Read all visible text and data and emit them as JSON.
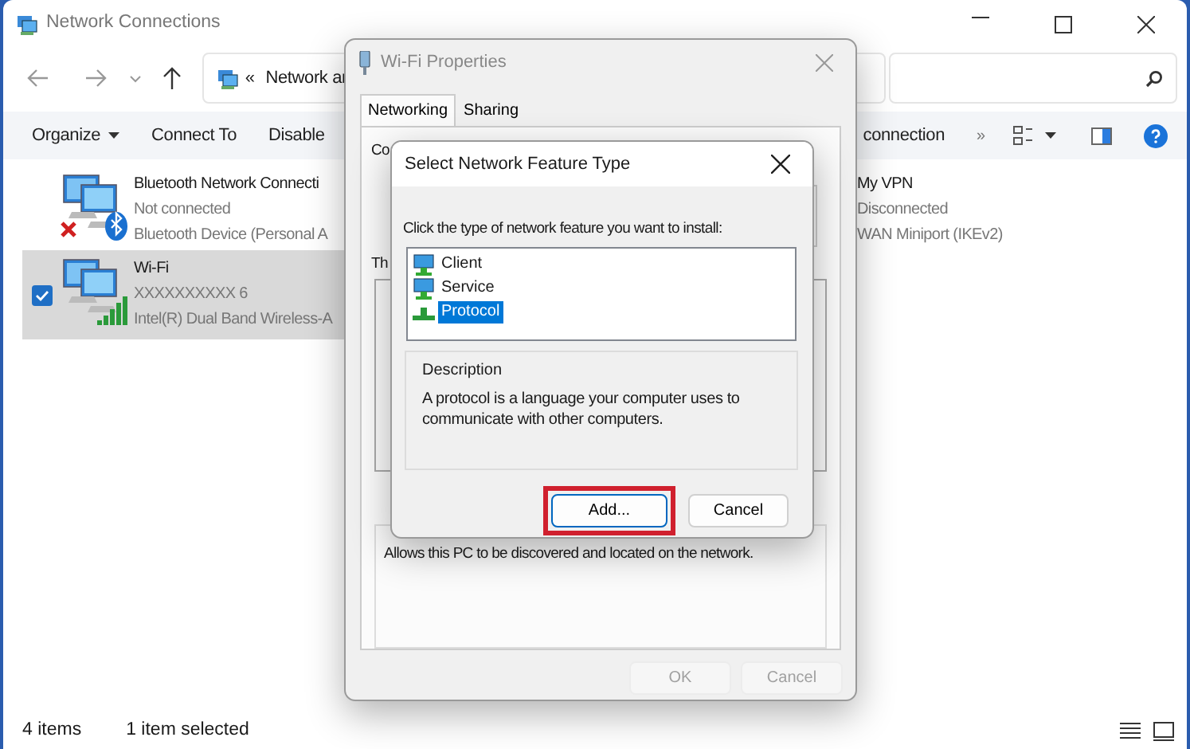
{
  "explorer": {
    "title": "Network Connections",
    "address_prefix": "«",
    "address": "Network ar",
    "toolbar": [
      {
        "label": "Organize",
        "dropdown": true
      },
      {
        "label": "Connect To",
        "dropdown": false
      },
      {
        "label": "Disable",
        "dropdown": false
      }
    ],
    "toolbar_right": {
      "label": "connection",
      "more": "»"
    },
    "connections": [
      {
        "kind": "bluetooth",
        "name": "Bluetooth Network Connecti",
        "status": "Not connected",
        "device": "Bluetooth Device (Personal A",
        "selected": false
      },
      {
        "kind": "wifi",
        "name": "Wi-Fi",
        "status": "XXXXXXXXXX 6",
        "device": "Intel(R) Dual Band Wireless-A",
        "selected": true
      },
      {
        "kind": "vpn",
        "name": "My VPN",
        "status": "Disconnected",
        "device": "WAN Miniport (IKEv2)",
        "selected": false
      }
    ],
    "status_bar": {
      "count": "4 items",
      "selection": "1 item selected"
    }
  },
  "properties": {
    "title": "Wi-Fi Properties",
    "tabs": [
      {
        "label": "Networking",
        "selected": true
      },
      {
        "label": "Sharing",
        "selected": false
      }
    ],
    "labels": [
      "Co",
      "Th"
    ],
    "description": "Allows this PC to be discovered and located on the network.",
    "buttons": [
      {
        "label": "OK",
        "disabled": true
      },
      {
        "label": "Cancel",
        "disabled": true
      }
    ]
  },
  "feature_dialog": {
    "title": "Select Network Feature Type",
    "prompt": "Click the type of network feature you want to install:",
    "items": [
      {
        "label": "Client",
        "selected": false
      },
      {
        "label": "Service",
        "selected": false
      },
      {
        "label": "Protocol",
        "selected": true
      }
    ],
    "description_title": "Description",
    "description": "A protocol is a language your computer uses to communicate with other computers.",
    "buttons": [
      {
        "label": "Add...",
        "highlighted": true
      },
      {
        "label": "Cancel",
        "highlighted": false
      }
    ]
  }
}
